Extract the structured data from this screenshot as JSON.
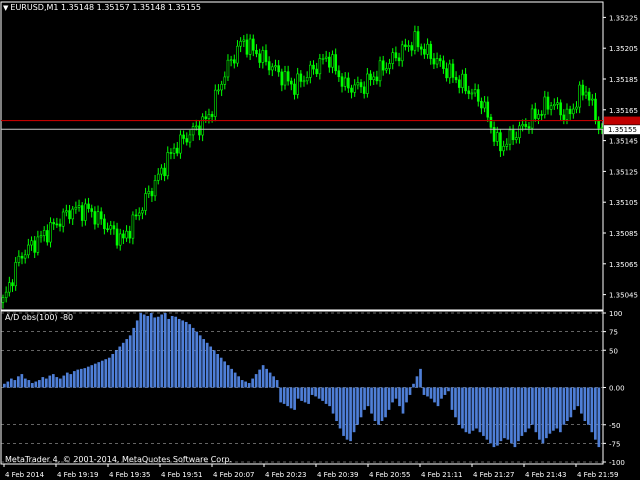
{
  "header": {
    "symbol_line": "EURUSD,M1  1.35148 1.35157 1.35148 1.35155",
    "dropdown_icon": "triangle-down-icon"
  },
  "indicator": {
    "label": "A/D obs(100) -80"
  },
  "footer": {
    "copyright": "MetaTrader 4, © 2001-2014, MetaQuotes Software Corp."
  },
  "colors": {
    "background": "#000000",
    "candle": "#00FF00",
    "histogram": "#4F7FD7",
    "red_line": "#C00000",
    "price_line": "#C8C8C8",
    "axis": "#FFFFFF",
    "current_price_bg": "#FFFFFF",
    "red_price_bg": "#C00000"
  },
  "price_axis": {
    "ticks": [
      "1.35225",
      "1.35205",
      "1.35185",
      "1.35165",
      "1.35145",
      "1.35125",
      "1.35105",
      "1.35085",
      "1.35065",
      "1.35045"
    ],
    "current_price_label": "1.35155",
    "red_level_value": 1.35158
  },
  "indicator_axis": {
    "ticks": [
      "100",
      "75",
      "50",
      "0.00",
      "-50",
      "-75",
      "-100"
    ]
  },
  "time_axis": {
    "labels": [
      "4 Feb 2014",
      "4 Feb 19:19",
      "4 Feb 19:35",
      "4 Feb 19:51",
      "4 Feb 20:07",
      "4 Feb 20:23",
      "4 Feb 20:39",
      "4 Feb 20:55",
      "4 Feb 21:11",
      "4 Feb 21:27",
      "4 Feb 21:43",
      "4 Feb 21:59"
    ]
  },
  "chart_data": [
    {
      "type": "candlestick",
      "title": "EURUSD,M1",
      "ylim": [
        1.35035,
        1.35235
      ],
      "x": [
        "4 Feb 2014",
        "4 Feb 19:19",
        "4 Feb 19:35",
        "4 Feb 19:51",
        "4 Feb 20:07",
        "4 Feb 20:23",
        "4 Feb 20:39",
        "4 Feb 20:55",
        "4 Feb 21:11",
        "4 Feb 21:27",
        "4 Feb 21:43",
        "4 Feb 21:59"
      ],
      "close_path": [
        1.3504,
        1.3507,
        1.3508,
        1.3509,
        1.351,
        1.351,
        1.3509,
        1.3508,
        1.351,
        1.3512,
        1.3514,
        1.3515,
        1.3516,
        1.3519,
        1.3521,
        1.352,
        1.3519,
        1.3518,
        1.3519,
        1.352,
        1.3518,
        1.3518,
        1.3519,
        1.352,
        1.3521,
        1.352,
        1.3519,
        1.3518,
        1.3517,
        1.3514,
        1.3515,
        1.3516,
        1.3517,
        1.3516,
        1.3518,
        1.3515
      ]
    },
    {
      "type": "bar",
      "title": "A/D obs(100) -80",
      "ylim": [
        -100,
        100
      ],
      "values": [
        5,
        8,
        12,
        10,
        15,
        18,
        12,
        10,
        6,
        8,
        10,
        14,
        12,
        16,
        18,
        14,
        12,
        16,
        20,
        18,
        22,
        24,
        25,
        26,
        28,
        30,
        32,
        34,
        36,
        38,
        40,
        45,
        50,
        55,
        60,
        65,
        70,
        80,
        90,
        100,
        98,
        96,
        100,
        94,
        95,
        98,
        100,
        92,
        96,
        95,
        92,
        90,
        88,
        85,
        80,
        75,
        70,
        65,
        60,
        55,
        50,
        45,
        40,
        35,
        30,
        25,
        20,
        15,
        10,
        8,
        6,
        12,
        18,
        24,
        30,
        25,
        20,
        15,
        10,
        -20,
        -22,
        -25,
        -28,
        -30,
        -15,
        -18,
        -20,
        -22,
        -10,
        -12,
        -15,
        -18,
        -22,
        -25,
        -35,
        -45,
        -55,
        -65,
        -70,
        -72,
        -60,
        -50,
        -40,
        -30,
        -25,
        -35,
        -45,
        -50,
        -45,
        -40,
        -30,
        -20,
        -15,
        -25,
        -35,
        -20,
        -10,
        5,
        15,
        25,
        -10,
        -12,
        -15,
        -20,
        -25,
        -15,
        -10,
        -5,
        -30,
        -40,
        -50,
        -55,
        -60,
        -62,
        -58,
        -55,
        -60,
        -65,
        -70,
        -75,
        -80,
        -78,
        -72,
        -68,
        -70,
        -75,
        -80,
        -72,
        -65,
        -60,
        -55,
        -50,
        -60,
        -70,
        -75,
        -68,
        -62,
        -58,
        -55,
        -60,
        -50,
        -45,
        -40,
        -30,
        -25,
        -35,
        -45,
        -50,
        -60,
        -70,
        -80
      ]
    }
  ]
}
